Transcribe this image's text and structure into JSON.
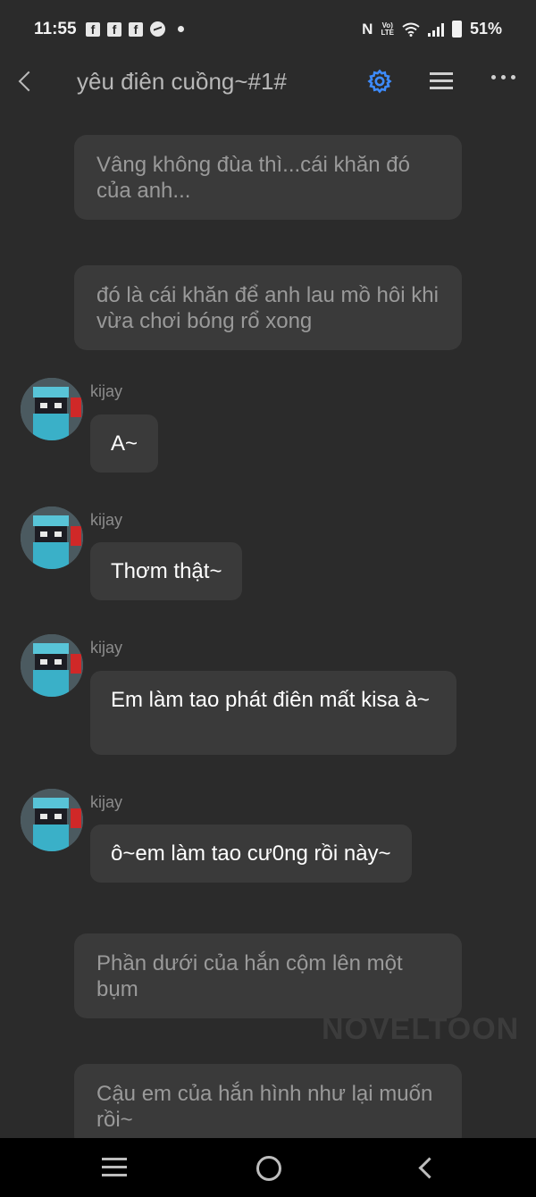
{
  "status_bar": {
    "time": "11:55",
    "battery": "51%",
    "network": "VoLTE",
    "icons": [
      "facebook-icon",
      "facebook-icon",
      "facebook-icon",
      "messenger-icon",
      "notification-dot",
      "nfc-icon",
      "volte-icon",
      "wifi-icon",
      "signal-icon",
      "battery-icon"
    ]
  },
  "header": {
    "title": "yêu điên cuồng~#1#",
    "settings_icon": "gear-icon",
    "list_icon": "list-icon",
    "more_icon": "more-icon",
    "accent_color": "#3d8bfd"
  },
  "messages": [
    {
      "type": "narration",
      "text": "Vâng không đùa thì...cái khăn đó của anh..."
    },
    {
      "type": "narration",
      "text": "đó là cái khăn để anh lau mồ hôi khi vừa chơi bóng rổ xong"
    },
    {
      "type": "chat",
      "user": "kijay",
      "text": "A~"
    },
    {
      "type": "chat",
      "user": "kijay",
      "text": "Thơm thật~"
    },
    {
      "type": "chat",
      "user": "kijay",
      "text": "Em làm tao phát điên mất kisa à~"
    },
    {
      "type": "chat",
      "user": "kijay",
      "text": "ô~em làm tao cư0ng rồi này~"
    },
    {
      "type": "narration",
      "text": "Phần dưới của hắn cộm lên một bụm"
    },
    {
      "type": "narration",
      "text": "Cậu em của hắn hình như lại muốn rồi~"
    }
  ],
  "watermark": "NOVELTOON",
  "nav_bar": {
    "icons": [
      "recent-apps-icon",
      "home-icon",
      "back-icon"
    ]
  }
}
